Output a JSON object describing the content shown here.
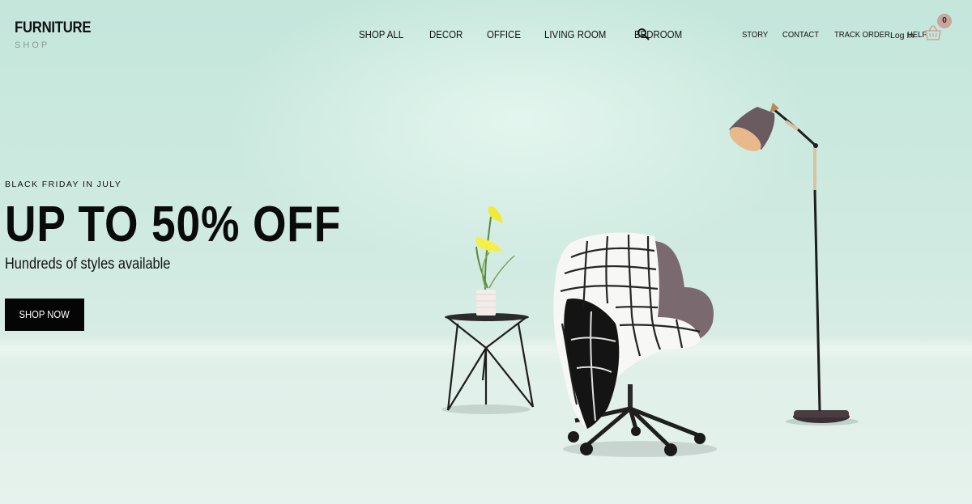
{
  "brand": {
    "name": "FURNITURE",
    "tagline": "SHOP"
  },
  "main_nav": [
    {
      "label": "SHOP ALL"
    },
    {
      "label": "DECOR"
    },
    {
      "label": "OFFICE"
    },
    {
      "label": "LIVING ROOM"
    },
    {
      "label": "BEDROOM"
    }
  ],
  "search": {
    "icon": "search-icon"
  },
  "util_nav": [
    {
      "label": "STORY"
    },
    {
      "label": "CONTACT"
    },
    {
      "label": "TRACK ORDER"
    },
    {
      "label": "HELP"
    }
  ],
  "account": {
    "login_label": "Log In"
  },
  "cart": {
    "icon": "basket-icon",
    "count": "0",
    "badge_color": "#c9a59c"
  },
  "promo": {
    "eyebrow": "BLACK FRIDAY IN JULY",
    "headline": "UP TO 50% OFF",
    "subhead": "Hundreds of styles available",
    "cta_label": "SHOP NOW"
  },
  "colors": {
    "background": "#cfe9df",
    "accent": "#050505"
  }
}
